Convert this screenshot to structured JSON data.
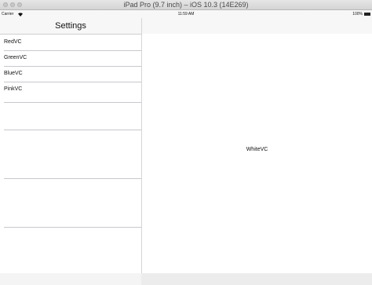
{
  "window": {
    "title": "iPad Pro (9.7 inch) – iOS 10.3 (14E269)"
  },
  "status_bar": {
    "carrier": "Carrier",
    "wifi_icon": "wifi-icon",
    "time": "11:59 AM",
    "battery_percent": "100%",
    "battery_icon": "battery-icon"
  },
  "master": {
    "title": "Settings",
    "items": [
      {
        "label": "RedVC"
      },
      {
        "label": "GreenVC"
      },
      {
        "label": "BlueVC"
      },
      {
        "label": "PinkVC"
      }
    ]
  },
  "detail": {
    "label": "WhiteVC"
  }
}
